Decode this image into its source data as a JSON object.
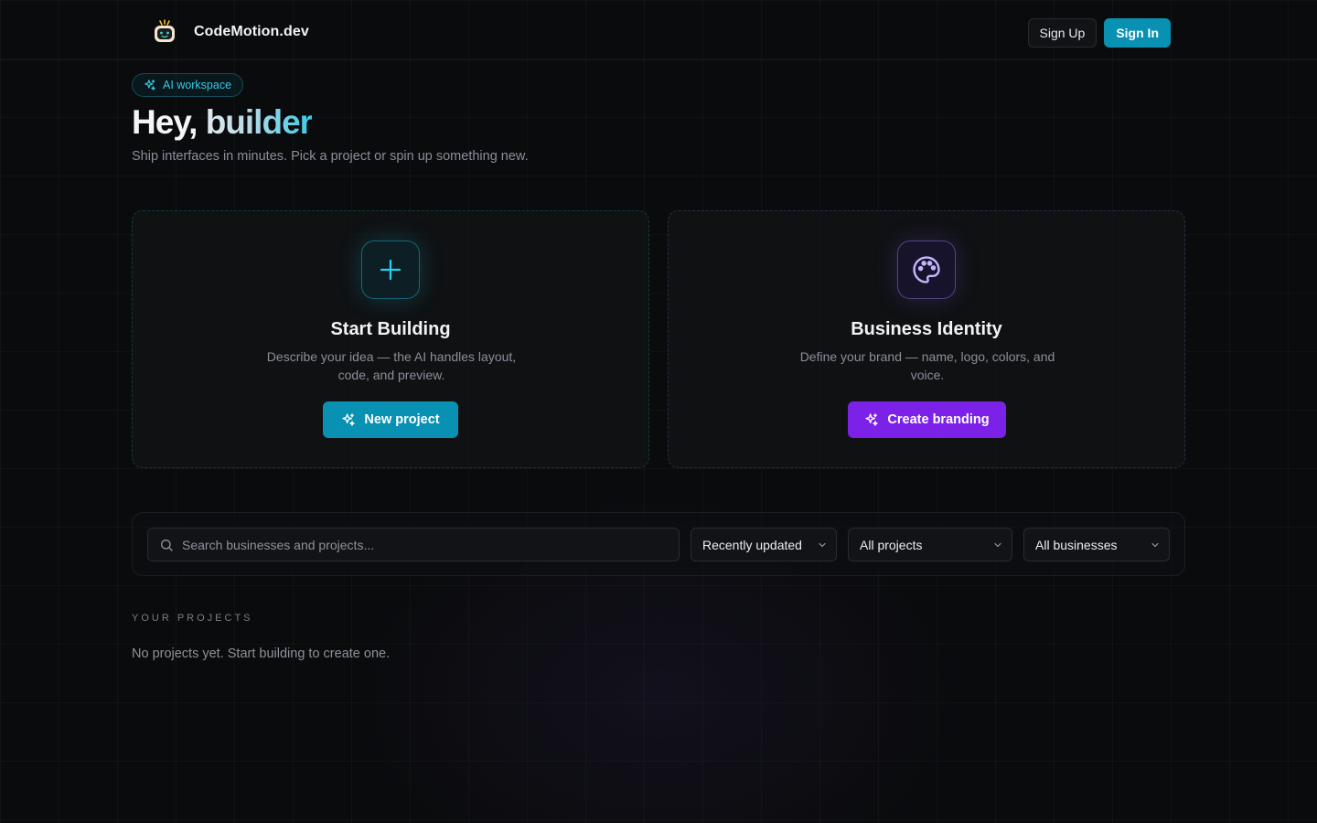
{
  "header": {
    "brand_name": "CodeMotion.dev",
    "logo_icon": "robot-icon",
    "signup_label": "Sign Up",
    "signin_label": "Sign In"
  },
  "hero": {
    "badge_label": "AI workspace",
    "greeting": "Hey,",
    "name": "builder",
    "subtitle": "Ship interfaces in minutes. Pick a project or spin up something new."
  },
  "cards": [
    {
      "icon": "plus-icon",
      "title": "Start Building",
      "description": "Describe your idea — the AI handles layout, code, and preview.",
      "button_label": "New project",
      "button_icon": "sparkles-icon"
    },
    {
      "icon": "palette-icon",
      "title": "Business Identity",
      "description": "Define your brand — name, logo, colors, and voice.",
      "button_label": "Create branding",
      "button_icon": "sparkles-icon"
    }
  ],
  "filters": {
    "search_placeholder": "Search businesses and projects...",
    "sort_value": "Recently updated",
    "project_value": "All projects",
    "business_value": "All businesses"
  },
  "projects": {
    "section_label": "YOUR PROJECTS",
    "empty_message": "No projects yet. Start building to create one."
  },
  "colors": {
    "background": "#0a0b0d",
    "accent_cyan": "#0891b2",
    "accent_purple": "#7c22e8"
  }
}
